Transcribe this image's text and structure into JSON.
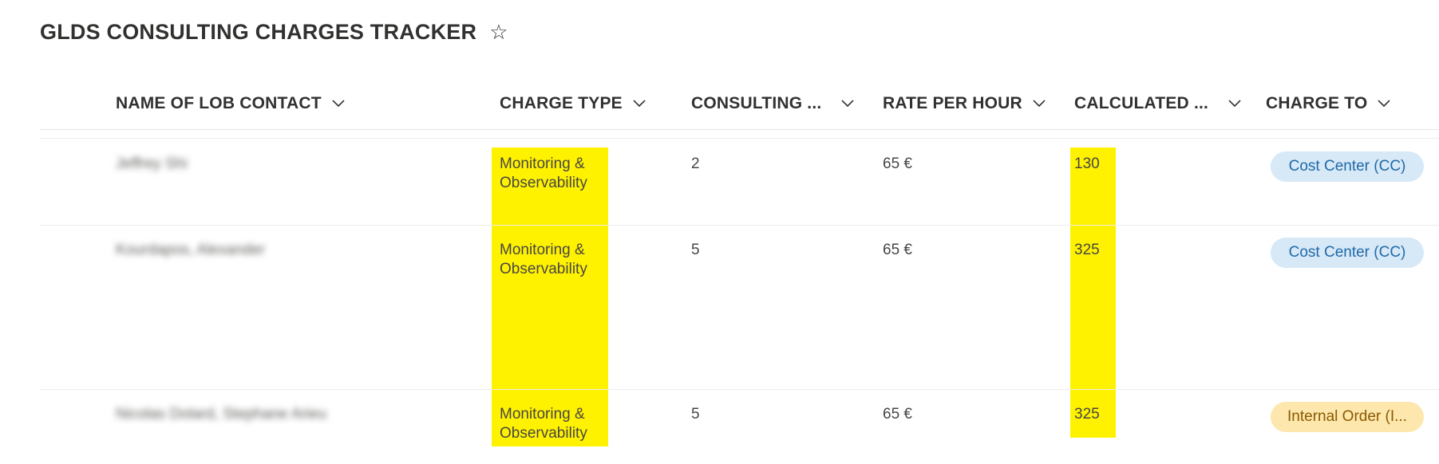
{
  "list": {
    "title": "GLDS CONSULTING CHARGES TRACKER",
    "favorite_icon": "☆"
  },
  "columns": [
    {
      "key": "name",
      "label": "NAME OF LOB CONTACT"
    },
    {
      "key": "charge_type",
      "label": "CHARGE TYPE"
    },
    {
      "key": "consulting",
      "label": "CONSULTING ..."
    },
    {
      "key": "rate",
      "label": "RATE PER HOUR"
    },
    {
      "key": "calculated",
      "label": "CALCULATED ..."
    },
    {
      "key": "charge_to",
      "label": "CHARGE TO"
    }
  ],
  "rows": [
    {
      "name": "Jeffrey Shi",
      "charge_type_line1": "Monitoring &",
      "charge_type_line2": "Observability",
      "consulting": "2",
      "rate": "65 €",
      "calculated": "130",
      "charge_to": "Cost Center (CC)",
      "charge_to_color": "#d7e8f7"
    },
    {
      "name": "Kourdapos, Alexander",
      "charge_type_line1": "Monitoring &",
      "charge_type_line2": "Observability",
      "consulting": "5",
      "rate": "65 €",
      "calculated": "325",
      "charge_to": "Cost Center (CC)",
      "charge_to_color": "#d7e8f7"
    },
    {
      "name": "Nicolas Dolard, Stephane Arieu",
      "charge_type_line1": "Monitoring &",
      "charge_type_line2": "Observability",
      "consulting": "5",
      "rate": "65 €",
      "calculated": "325",
      "charge_to": "Internal Order (I...",
      "charge_to_color": "#fde7ad"
    }
  ],
  "colors": {
    "highlight": "#fff200",
    "header_text": "#323130"
  }
}
